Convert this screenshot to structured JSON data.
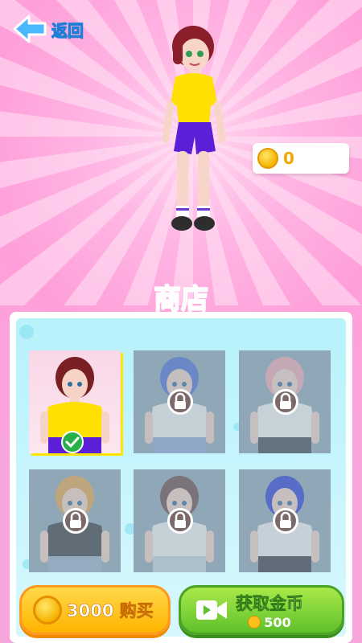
{
  "header": {
    "back_label": "返回"
  },
  "wallet": {
    "coins": "0"
  },
  "shop": {
    "title": "商店"
  },
  "skins": [
    {
      "hair": "#7a1f24",
      "skin": "#f6d3c6",
      "shirt": "#ffe000",
      "pants": "#5b1fd8",
      "state": "selected"
    },
    {
      "hair": "#4b6fd1",
      "skin": "#f2d1c6",
      "shirt": "#f1f1f1",
      "pants": "#8fa9d6",
      "state": "locked"
    },
    {
      "hair": "#f0a9b5",
      "skin": "#f3d4c9",
      "shirt": "#f4f4f4",
      "pants": "#444a55",
      "state": "locked"
    },
    {
      "hair": "#e7a44b",
      "skin": "#f3d3c5",
      "shirt": "#3b3e44",
      "pants": "#9bb0c9",
      "state": "locked"
    },
    {
      "hair": "#6b4a4a",
      "skin": "#f3d3c5",
      "shirt": "#f2f2f2",
      "pants": "#c9d4de",
      "state": "locked"
    },
    {
      "hair": "#2a3fd6",
      "skin": "#f3d3c5",
      "shirt": "#f3f3f3",
      "pants": "#3a3e46",
      "state": "locked"
    }
  ],
  "actions": {
    "buy_label": "3000 购买",
    "get_coins_label": "获取金币",
    "get_coins_amount": "500"
  },
  "colors": {
    "title": "#2ec0ff",
    "buy": "#ffc21c",
    "get": "#6cc631",
    "background": "#ff9fd9"
  }
}
